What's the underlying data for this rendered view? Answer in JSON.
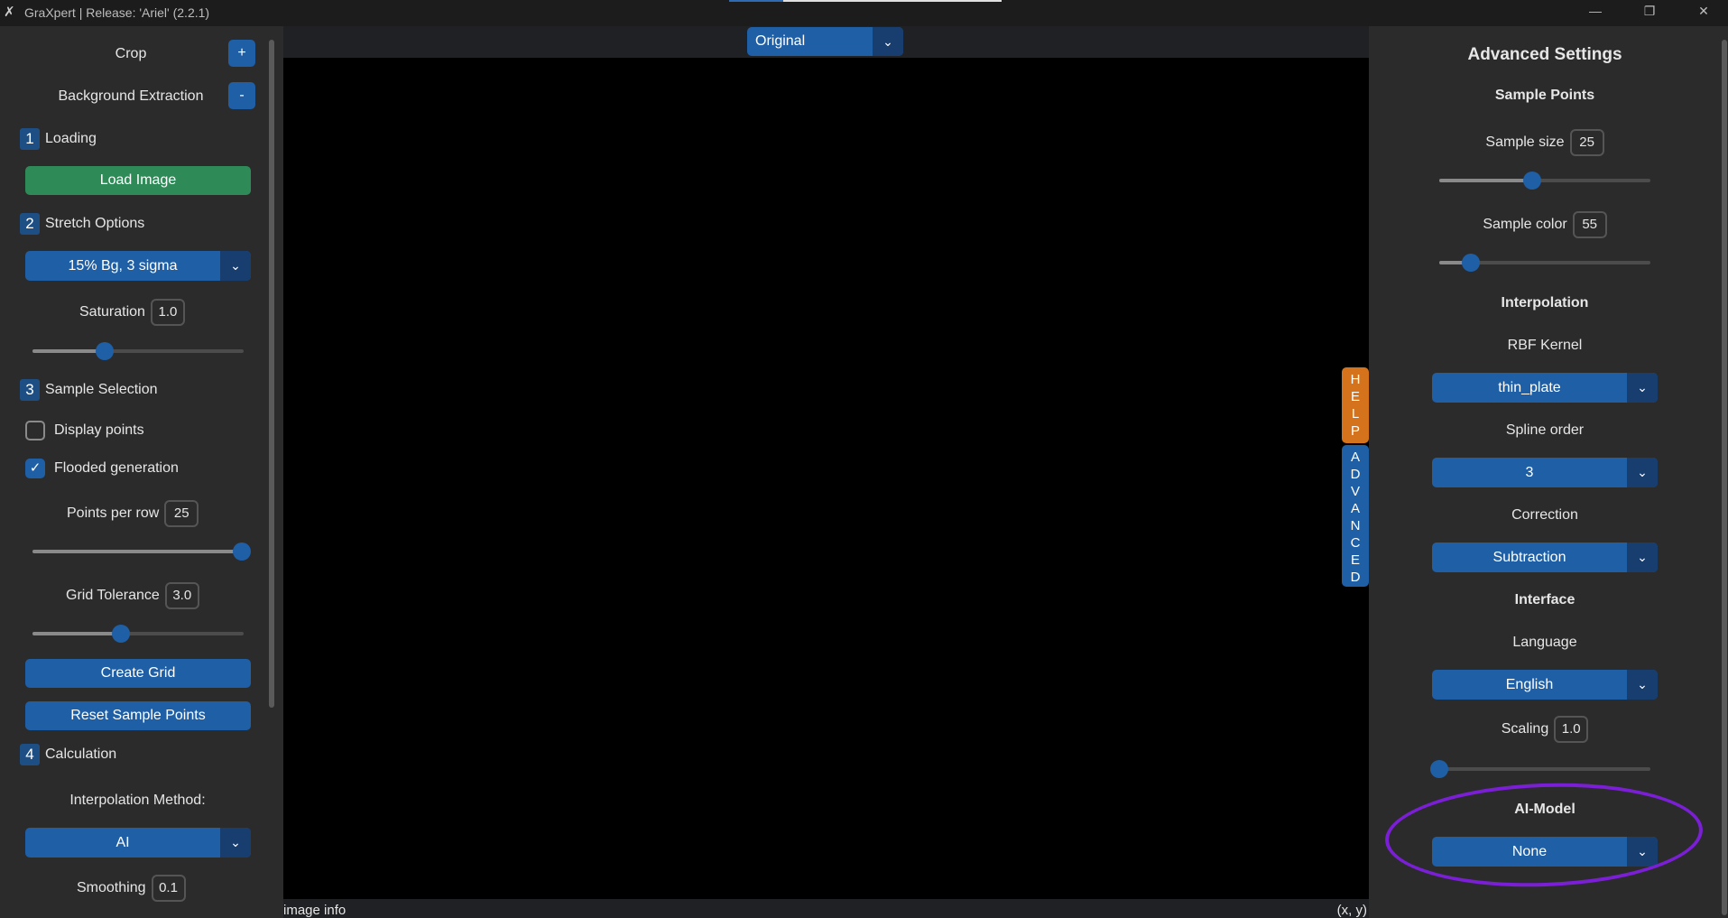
{
  "window": {
    "title": "GraXpert | Release: 'Ariel' (2.2.1)",
    "app_icon": "graxpert-icon",
    "controls": [
      "—",
      "❐",
      "✕"
    ]
  },
  "left": {
    "crop": {
      "label": "Crop",
      "button": "+"
    },
    "bg_extraction": {
      "label": "Background Extraction",
      "button": "-"
    },
    "loading": {
      "num": "1",
      "label": "Loading",
      "load_button": "Load Image"
    },
    "stretch": {
      "num": "2",
      "label": "Stretch Options",
      "preset": "15% Bg, 3 sigma",
      "saturation_label": "Saturation",
      "saturation_value": "1.0",
      "saturation_level": 0.34
    },
    "sample": {
      "num": "3",
      "label": "Sample Selection",
      "display_points": "Display points",
      "display_points_checked": false,
      "flooded": "Flooded generation",
      "flooded_checked": true,
      "points_per_row_label": "Points per row",
      "points_per_row_value": "25",
      "points_per_row_level": 1.0,
      "grid_tol_label": "Grid Tolerance",
      "grid_tol_value": "3.0",
      "grid_tol_level": 0.42,
      "create_grid": "Create Grid",
      "reset_points": "Reset Sample Points"
    },
    "calc": {
      "num": "4",
      "label": "Calculation",
      "interp_label": "Interpolation Method:",
      "interp_value": "AI",
      "smoothing_label": "Smoothing",
      "smoothing_value": "0.1"
    }
  },
  "center": {
    "view_select": "Original",
    "image_info": "image info",
    "coords": "(x, y)",
    "help_tab": "HELP",
    "advanced_tab": "ADVANCED"
  },
  "right": {
    "title": "Advanced Settings",
    "sample_points_head": "Sample Points",
    "sample_size_label": "Sample size",
    "sample_size_value": "25",
    "sample_size_level": 0.44,
    "sample_color_label": "Sample color",
    "sample_color_value": "55",
    "sample_color_level": 0.15,
    "interp_head": "Interpolation",
    "rbf_label": "RBF Kernel",
    "rbf_value": "thin_plate",
    "spline_label": "Spline order",
    "spline_value": "3",
    "correction_label": "Correction",
    "correction_value": "Subtraction",
    "interface_head": "Interface",
    "language_label": "Language",
    "language_value": "English",
    "scaling_label": "Scaling",
    "scaling_value": "1.0",
    "scaling_level": 0.0,
    "ai_model_head": "AI-Model",
    "ai_model_value": "None"
  },
  "colors": {
    "accent": "#1f5fa6",
    "green": "#2e8b57",
    "help": "#d4731c",
    "highlight": "#7b1fd6"
  }
}
